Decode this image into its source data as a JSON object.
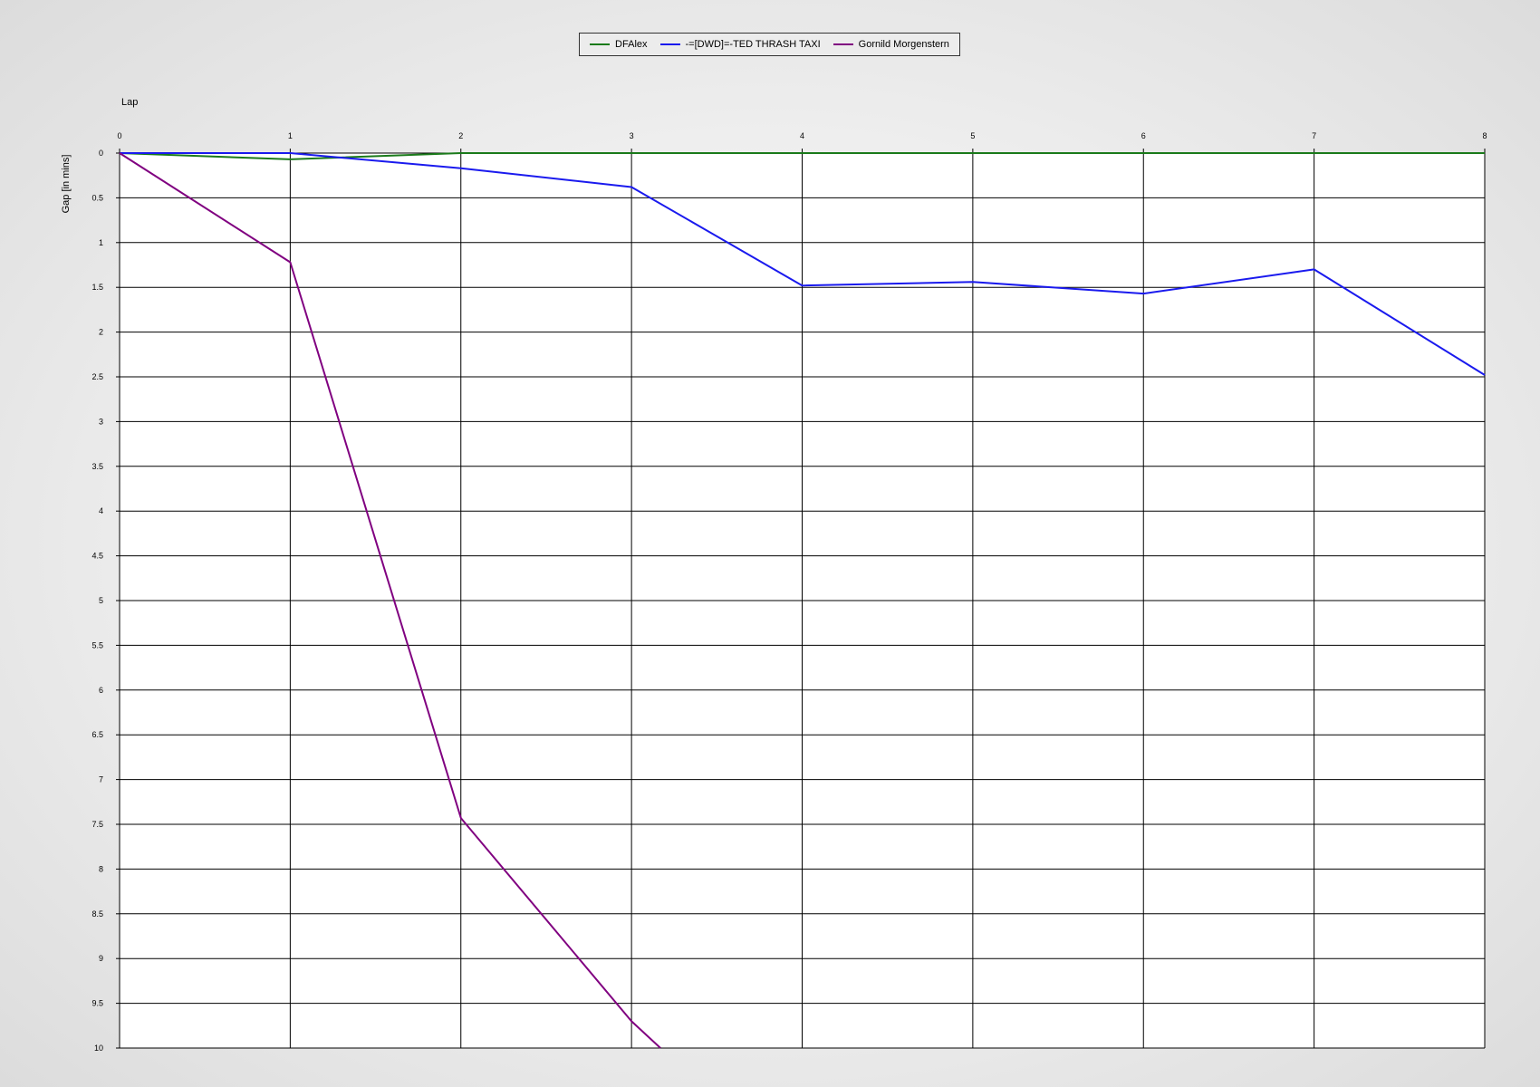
{
  "chart_data": {
    "type": "line",
    "title": "",
    "xlabel": "Lap",
    "ylabel": "Gap [in mins]",
    "xlim": [
      0,
      8
    ],
    "ylim": [
      0,
      10
    ],
    "y_inverted": true,
    "x_axis_position": "top",
    "grid": true,
    "legend_placement": "top-center",
    "x_ticks": [
      "0",
      "1",
      "2",
      "3",
      "4",
      "5",
      "6",
      "7",
      "8"
    ],
    "y_ticks": [
      "0",
      "0.5",
      "1",
      "1.5",
      "2",
      "2.5",
      "3",
      "3.5",
      "4",
      "4.5",
      "5",
      "5.5",
      "6",
      "6.5",
      "7",
      "7.5",
      "8",
      "8.5",
      "9",
      "9.5",
      "10"
    ],
    "series": [
      {
        "name": "DFAlex",
        "color": "#1a7a1a",
        "points": [
          [
            0,
            0
          ],
          [
            1,
            0.07
          ],
          [
            2,
            0
          ],
          [
            3,
            0
          ],
          [
            4,
            0
          ],
          [
            5,
            0
          ],
          [
            6,
            0
          ],
          [
            7,
            0
          ],
          [
            8,
            0
          ]
        ]
      },
      {
        "name": "-=[DWD]=-TED THRASH TAXI",
        "color": "#1a1aee",
        "points": [
          [
            0,
            0
          ],
          [
            1,
            0
          ],
          [
            2,
            0.17
          ],
          [
            3,
            0.38
          ],
          [
            4,
            1.48
          ],
          [
            5,
            1.44
          ],
          [
            6,
            1.57
          ],
          [
            7,
            1.3
          ],
          [
            8,
            2.48
          ]
        ]
      },
      {
        "name": "Gornild Morgenstern",
        "color": "#800080",
        "points": [
          [
            0,
            0
          ],
          [
            1,
            1.22
          ],
          [
            2,
            7.43
          ],
          [
            3,
            9.7
          ],
          [
            3.17,
            10
          ]
        ]
      }
    ]
  }
}
